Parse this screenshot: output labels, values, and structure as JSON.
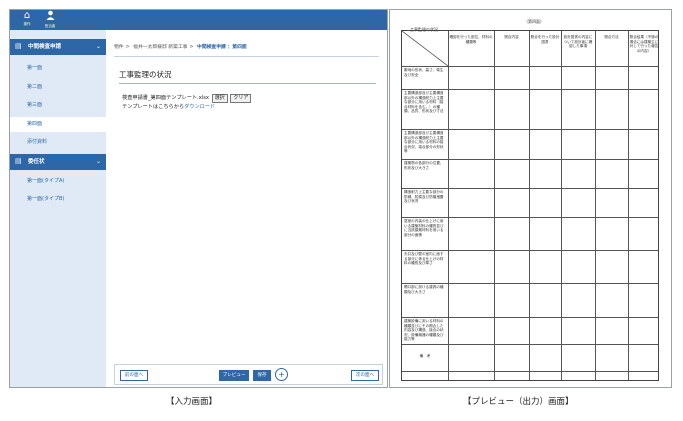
{
  "topbar": {
    "home_label": "操作",
    "user_label": "担当者"
  },
  "sidebar": {
    "groups": [
      {
        "title": "中間検査申請",
        "items": [
          {
            "label": "第一面"
          },
          {
            "label": "第二面"
          },
          {
            "label": "第三面"
          },
          {
            "label": "第四面"
          },
          {
            "label": "添付資料"
          }
        ]
      },
      {
        "title": "委任状",
        "items": [
          {
            "label": "第一面(タイプA)"
          },
          {
            "label": "第一面(タイプB)"
          }
        ]
      }
    ],
    "active_item": "第四面"
  },
  "breadcrumb": [
    "物件",
    "福井一太郎様邸 新築工事",
    "中間検査申請 ：第四面"
  ],
  "main": {
    "section_title": "工事監理の状況",
    "template_file": "検査申請書_第四面テンプレート.xlsx",
    "select_label": "選択",
    "clear_label": "クリア",
    "download_text_prefix": "テンプレートはこちらから",
    "download_link": "ダウンロード"
  },
  "footer": {
    "prev_label": "前の面へ",
    "preview_label": "プレビュー",
    "save_label": "保存",
    "plus_label": "+",
    "next_label": "次の面へ"
  },
  "preview": {
    "form_no": "（第四面）",
    "table_title": "工事監理の状況",
    "headers": [
      "確認を行った部位、材料の種類等",
      "照合内容",
      "照合を行った設計図書",
      "設計図書の内容について設計者に確認した事項",
      "照合方法",
      "照合結果（不適の場合には建築主に対して行った報告の内容）"
    ],
    "rows": [
      "敷地の形状、高さ、衛生及び安全",
      "主要構造部及び主要構造部以外の構造耐力上主要な部分に用いる材料（接合材料を含む。）の種類、品質、形状及び寸法",
      "主要構造部及び主要構造部以外の構造耐力上主要な部分に用いる材料の接合状況、接合部分の形状等",
      "建築物の各部分の位置、形状及び大きさ",
      "構造耐力上主要な部分の防錆、防腐及び防蟻措置及び状況",
      "居室の内装の仕上げに用いる建築材料の種別並びに当該建築材料を用いる部分の面積",
      "天井及び壁の室内に面する部分に係る仕上げの材料の種別及び厚さ",
      "開口部に設ける建具の種類及び大きさ",
      "建築設備に用いる材料の種類並びにその照合した内容及び構造、接合の状況、設備機器の種類及び能力等",
      "備　考"
    ]
  },
  "captions": {
    "input": "【入力画面】",
    "preview": "【プレビュー（出力）画面】"
  }
}
